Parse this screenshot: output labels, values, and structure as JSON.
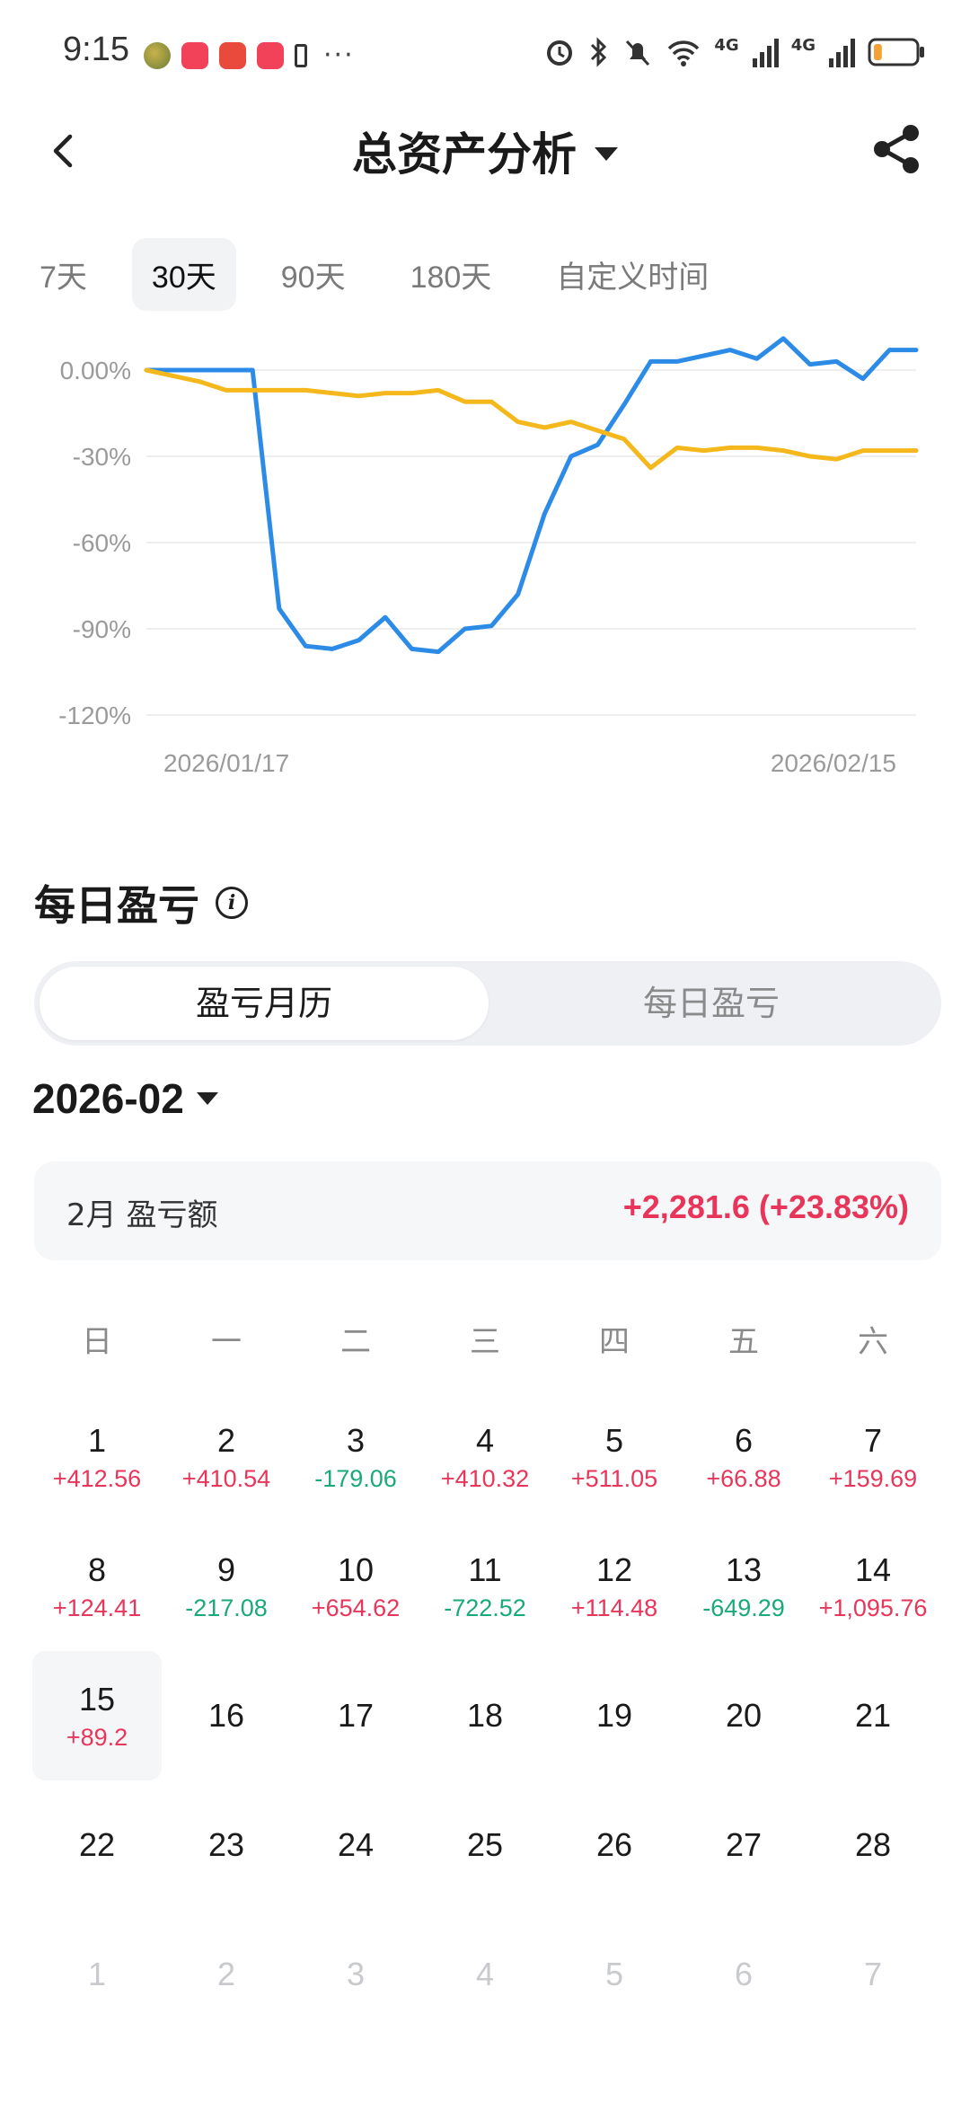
{
  "status_bar": {
    "time": "9:15",
    "app_icons": [
      "gallery-app-icon",
      "red-note-app-icon",
      "huawei-app-icon",
      "red-note-app-icon",
      "battery-alert-icon"
    ],
    "more": "···",
    "network_labels": [
      "4G",
      "4G"
    ],
    "battery_level": 0.2
  },
  "header": {
    "title": "总资产分析"
  },
  "range_tabs": [
    {
      "label": "7天",
      "active": false
    },
    {
      "label": "30天",
      "active": true
    },
    {
      "label": "90天",
      "active": false
    },
    {
      "label": "180天",
      "active": false
    },
    {
      "label": "自定义时间",
      "active": false
    }
  ],
  "chart_data": {
    "type": "line",
    "y_ticks": [
      "0.00%",
      "-30%",
      "-60%",
      "-90%",
      "-120%"
    ],
    "y_tick_values": [
      0,
      -30,
      -60,
      -90,
      -120
    ],
    "x_tick_labels": [
      "2026/01/17",
      "2026/02/15"
    ],
    "ylim": [
      -120,
      5
    ],
    "grid": true,
    "series": [
      {
        "color": "#2b8be6",
        "values": [
          0,
          0,
          0,
          0,
          0,
          -83,
          -96,
          -97,
          -94,
          -86,
          -97,
          -98,
          -90,
          -89,
          -78,
          -50,
          -30,
          -26,
          -12,
          3,
          3,
          5,
          7,
          4,
          11,
          2,
          3,
          -3,
          7,
          7
        ]
      },
      {
        "color": "#f4b81c",
        "values": [
          0,
          -2,
          -4,
          -7,
          -7,
          -7,
          -7,
          -8,
          -9,
          -8,
          -8,
          -7,
          -11,
          -11,
          -18,
          -20,
          -18,
          -21,
          -24,
          -34,
          -27,
          -28,
          -27,
          -27,
          -28,
          -30,
          -31,
          -28,
          -28,
          -28
        ]
      }
    ]
  },
  "section": {
    "title": "每日盈亏",
    "info_glyph": "i"
  },
  "segment": {
    "left": "盈亏月历",
    "right": "每日盈亏"
  },
  "month_selector": "2026-02",
  "summary": {
    "label": "2月 盈亏额",
    "value": "+2,281.6 (+23.83%)"
  },
  "calendar": {
    "weekdays": [
      "日",
      "一",
      "二",
      "三",
      "四",
      "五",
      "六"
    ],
    "weeks": [
      [
        {
          "d": "1",
          "v": "+412.56"
        },
        {
          "d": "2",
          "v": "+410.54"
        },
        {
          "d": "3",
          "v": "-179.06"
        },
        {
          "d": "4",
          "v": "+410.32"
        },
        {
          "d": "5",
          "v": "+511.05"
        },
        {
          "d": "6",
          "v": "+66.88"
        },
        {
          "d": "7",
          "v": "+159.69"
        }
      ],
      [
        {
          "d": "8",
          "v": "+124.41"
        },
        {
          "d": "9",
          "v": "-217.08"
        },
        {
          "d": "10",
          "v": "+654.62"
        },
        {
          "d": "11",
          "v": "-722.52"
        },
        {
          "d": "12",
          "v": "+114.48"
        },
        {
          "d": "13",
          "v": "-649.29"
        },
        {
          "d": "14",
          "v": "+1,095.76"
        }
      ],
      [
        {
          "d": "15",
          "v": "+89.2",
          "today": true
        },
        {
          "d": "16",
          "v": ""
        },
        {
          "d": "17",
          "v": ""
        },
        {
          "d": "18",
          "v": ""
        },
        {
          "d": "19",
          "v": ""
        },
        {
          "d": "20",
          "v": ""
        },
        {
          "d": "21",
          "v": ""
        }
      ],
      [
        {
          "d": "22",
          "v": ""
        },
        {
          "d": "23",
          "v": ""
        },
        {
          "d": "24",
          "v": ""
        },
        {
          "d": "25",
          "v": ""
        },
        {
          "d": "26",
          "v": ""
        },
        {
          "d": "27",
          "v": ""
        },
        {
          "d": "28",
          "v": ""
        }
      ],
      [
        {
          "d": "1",
          "v": "",
          "next": true
        },
        {
          "d": "2",
          "v": "",
          "next": true
        },
        {
          "d": "3",
          "v": "",
          "next": true
        },
        {
          "d": "4",
          "v": "",
          "next": true
        },
        {
          "d": "5",
          "v": "",
          "next": true
        },
        {
          "d": "6",
          "v": "",
          "next": true
        },
        {
          "d": "7",
          "v": "",
          "next": true
        }
      ]
    ]
  },
  "colors": {
    "positive": "#e8365a",
    "negative": "#1aa97a",
    "accent_blue": "#2b8be6",
    "accent_yellow": "#f4b81c"
  }
}
